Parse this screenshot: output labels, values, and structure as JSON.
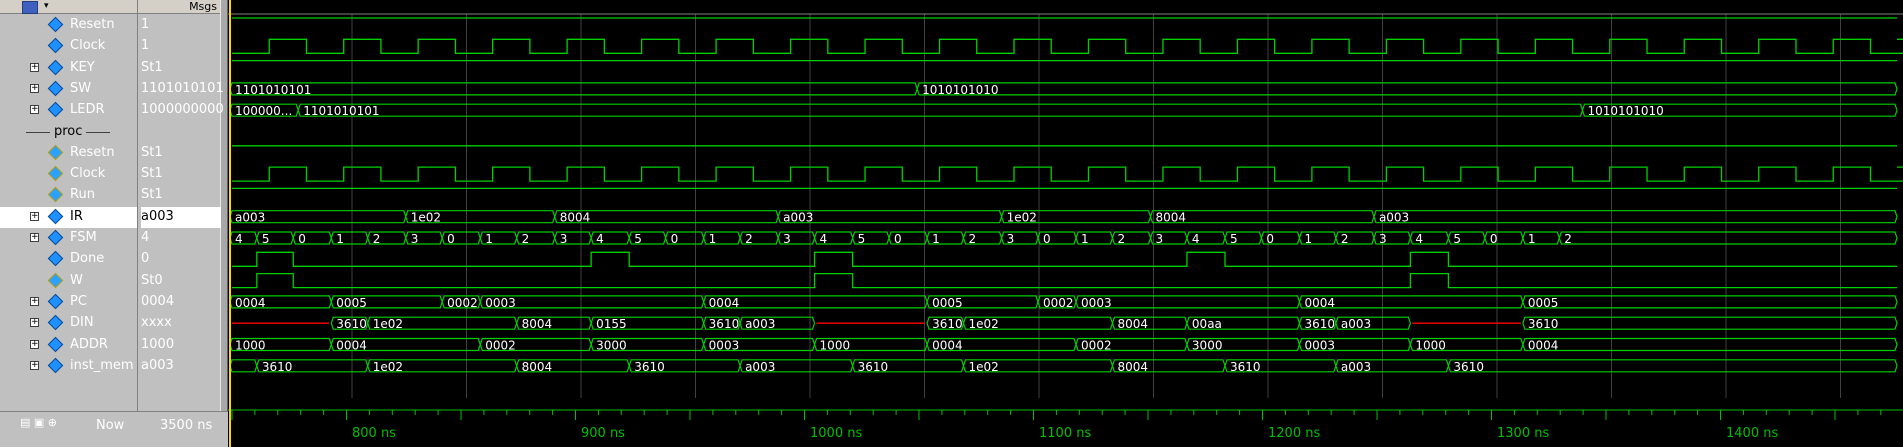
{
  "header": {
    "msgs_label": "Msgs"
  },
  "signals": [
    {
      "name": "Resetn",
      "value": "1",
      "expand": false,
      "kind": "in"
    },
    {
      "name": "Clock",
      "value": "1",
      "expand": false,
      "kind": "in"
    },
    {
      "name": "KEY",
      "value": "St1",
      "expand": true,
      "kind": "in"
    },
    {
      "name": "SW",
      "value": "1101010101",
      "expand": true,
      "kind": "in"
    },
    {
      "name": "LEDR",
      "value": "1000000000",
      "expand": true,
      "kind": "in"
    },
    {
      "name": "proc",
      "value": "",
      "expand": false,
      "kind": "group"
    },
    {
      "name": "Resetn",
      "value": "St1",
      "expand": false,
      "kind": "port"
    },
    {
      "name": "Clock",
      "value": "St1",
      "expand": false,
      "kind": "port"
    },
    {
      "name": "Run",
      "value": "St1",
      "expand": false,
      "kind": "port"
    },
    {
      "name": "IR",
      "value": "a003",
      "expand": true,
      "kind": "in",
      "selected": true
    },
    {
      "name": "FSM",
      "value": "4",
      "expand": true,
      "kind": "in"
    },
    {
      "name": "Done",
      "value": "0",
      "expand": false,
      "kind": "in"
    },
    {
      "name": "W",
      "value": "St0",
      "expand": false,
      "kind": "port"
    },
    {
      "name": "PC",
      "value": "0004",
      "expand": true,
      "kind": "in"
    },
    {
      "name": "DIN",
      "value": "xxxx",
      "expand": true,
      "kind": "in"
    },
    {
      "name": "ADDR",
      "value": "1000",
      "expand": true,
      "kind": "in"
    },
    {
      "name": "inst_mem",
      "value": "a003",
      "expand": true,
      "kind": "in"
    }
  ],
  "status": {
    "now_label": "Now",
    "now_value": "3500 ns"
  },
  "timeline": {
    "ticks": [
      "800 ns",
      "900 ns",
      "1000 ns",
      "1100 ns",
      "1200 ns",
      "1300 ns",
      "1400 ns"
    ]
  },
  "buses": {
    "SW": [
      {
        "t": 0,
        "v": "1101010101"
      },
      {
        "t": 0.414,
        "v": "1010101010"
      }
    ],
    "LEDR": [
      {
        "t": 0,
        "v": "100000..."
      },
      {
        "t": 0.04,
        "v": "1101010101"
      },
      {
        "t": 0.816,
        "v": "1010101010"
      }
    ],
    "IR": [
      {
        "t": 0,
        "v": "a003"
      },
      {
        "t": 0.105,
        "v": "1e02"
      },
      {
        "t": 0.195,
        "v": "8004"
      },
      {
        "t": 0.33,
        "v": "a003"
      },
      {
        "t": 0.465,
        "v": "1e02"
      },
      {
        "t": 0.555,
        "v": "8004"
      },
      {
        "t": 0.69,
        "v": "a003"
      }
    ],
    "FSM": [
      {
        "t": 0,
        "v": "4"
      },
      {
        "t": 0.015,
        "v": "5"
      },
      {
        "t": 0.037,
        "v": "0"
      },
      {
        "t": 0.06,
        "v": "1"
      },
      {
        "t": 0.082,
        "v": "2"
      },
      {
        "t": 0.105,
        "v": "3"
      },
      {
        "t": 0.127,
        "v": "0"
      },
      {
        "t": 0.15,
        "v": "1"
      },
      {
        "t": 0.172,
        "v": "2"
      },
      {
        "t": 0.195,
        "v": "3"
      },
      {
        "t": 0.217,
        "v": "4"
      },
      {
        "t": 0.24,
        "v": "5"
      },
      {
        "t": 0.262,
        "v": "0"
      },
      {
        "t": 0.285,
        "v": "1"
      },
      {
        "t": 0.307,
        "v": "2"
      },
      {
        "t": 0.33,
        "v": "3"
      },
      {
        "t": 0.352,
        "v": "4"
      },
      {
        "t": 0.375,
        "v": "5"
      },
      {
        "t": 0.397,
        "v": "0"
      },
      {
        "t": 0.42,
        "v": "1"
      },
      {
        "t": 0.442,
        "v": "2"
      },
      {
        "t": 0.465,
        "v": "3"
      },
      {
        "t": 0.487,
        "v": "0"
      },
      {
        "t": 0.51,
        "v": "1"
      },
      {
        "t": 0.532,
        "v": "2"
      },
      {
        "t": 0.555,
        "v": "3"
      },
      {
        "t": 0.577,
        "v": "4"
      },
      {
        "t": 0.6,
        "v": "5"
      },
      {
        "t": 0.622,
        "v": "0"
      },
      {
        "t": 0.645,
        "v": "1"
      },
      {
        "t": 0.667,
        "v": "2"
      },
      {
        "t": 0.69,
        "v": "3"
      },
      {
        "t": 0.712,
        "v": "4"
      },
      {
        "t": 0.735,
        "v": "5"
      },
      {
        "t": 0.757,
        "v": "0"
      },
      {
        "t": 0.78,
        "v": "1"
      },
      {
        "t": 0.802,
        "v": "2"
      }
    ],
    "PC": [
      {
        "t": 0,
        "v": "0004"
      },
      {
        "t": 0.06,
        "v": "0005"
      },
      {
        "t": 0.127,
        "v": "0002"
      },
      {
        "t": 0.15,
        "v": "0003"
      },
      {
        "t": 0.285,
        "v": "0004"
      },
      {
        "t": 0.42,
        "v": "0005"
      },
      {
        "t": 0.487,
        "v": "0002"
      },
      {
        "t": 0.51,
        "v": "0003"
      },
      {
        "t": 0.645,
        "v": "0004"
      },
      {
        "t": 0.78,
        "v": "0005"
      }
    ],
    "DIN": [
      {
        "t": 0,
        "v": "",
        "x": true
      },
      {
        "t": 0.06,
        "v": "3610"
      },
      {
        "t": 0.082,
        "v": "1e02"
      },
      {
        "t": 0.172,
        "v": "8004"
      },
      {
        "t": 0.217,
        "v": "0155"
      },
      {
        "t": 0.285,
        "v": "3610"
      },
      {
        "t": 0.307,
        "v": "a003"
      },
      {
        "t": 0.352,
        "v": "",
        "x": true
      },
      {
        "t": 0.42,
        "v": "3610"
      },
      {
        "t": 0.442,
        "v": "1e02"
      },
      {
        "t": 0.532,
        "v": "8004"
      },
      {
        "t": 0.577,
        "v": "00aa"
      },
      {
        "t": 0.645,
        "v": "3610"
      },
      {
        "t": 0.667,
        "v": "a003"
      },
      {
        "t": 0.712,
        "v": "",
        "x": true
      },
      {
        "t": 0.78,
        "v": "3610"
      }
    ],
    "ADDR": [
      {
        "t": 0,
        "v": "1000"
      },
      {
        "t": 0.06,
        "v": "0004"
      },
      {
        "t": 0.15,
        "v": "0002"
      },
      {
        "t": 0.217,
        "v": "3000"
      },
      {
        "t": 0.285,
        "v": "0003"
      },
      {
        "t": 0.352,
        "v": "1000"
      },
      {
        "t": 0.42,
        "v": "0004"
      },
      {
        "t": 0.51,
        "v": "0002"
      },
      {
        "t": 0.577,
        "v": "3000"
      },
      {
        "t": 0.645,
        "v": "0003"
      },
      {
        "t": 0.712,
        "v": "1000"
      },
      {
        "t": 0.78,
        "v": "0004"
      }
    ],
    "inst_mem": [
      {
        "t": 0,
        "v": ""
      },
      {
        "t": 0.015,
        "v": "3610"
      },
      {
        "t": 0.082,
        "v": "1e02"
      },
      {
        "t": 0.172,
        "v": "8004"
      },
      {
        "t": 0.24,
        "v": "3610"
      },
      {
        "t": 0.307,
        "v": "a003"
      },
      {
        "t": 0.375,
        "v": "3610"
      },
      {
        "t": 0.442,
        "v": "1e02"
      },
      {
        "t": 0.532,
        "v": "8004"
      },
      {
        "t": 0.6,
        "v": "3610"
      },
      {
        "t": 0.667,
        "v": "a003"
      },
      {
        "t": 0.735,
        "v": "3610"
      }
    ]
  },
  "colors": {
    "wave": "#00d000",
    "undefined": "#ff0000",
    "cursor": "#ffd700",
    "grid": "#404040",
    "tick_text": "#00c000"
  }
}
